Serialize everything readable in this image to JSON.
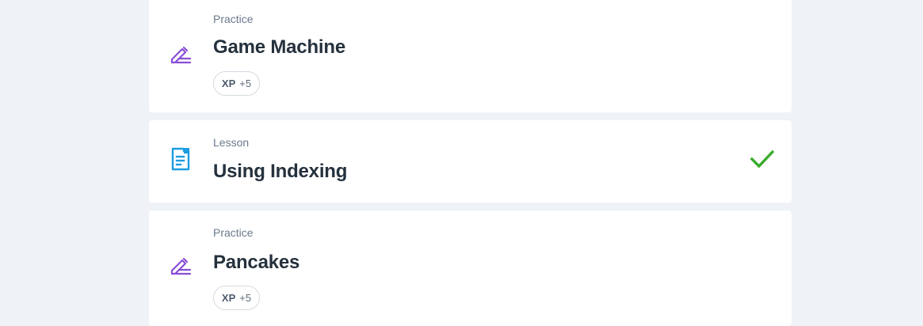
{
  "items": [
    {
      "kind": "Practice",
      "title": "Game Machine",
      "xp_label": "XP",
      "xp_value": "+5",
      "icon": "pencil-icon",
      "completed": false
    },
    {
      "kind": "Lesson",
      "title": "Using Indexing",
      "icon": "document-icon",
      "completed": true
    },
    {
      "kind": "Practice",
      "title": "Pancakes",
      "xp_label": "XP",
      "xp_value": "+5",
      "icon": "pencil-icon",
      "completed": false
    }
  ],
  "colors": {
    "page_background": "#eff3f7",
    "card_background": "#ffffff",
    "practice_icon": "#8a4dd6",
    "lesson_icon": "#1b9de0",
    "checkmark": "#3aab2c",
    "title_text": "#25313d",
    "kind_text": "#6b7a8c"
  }
}
